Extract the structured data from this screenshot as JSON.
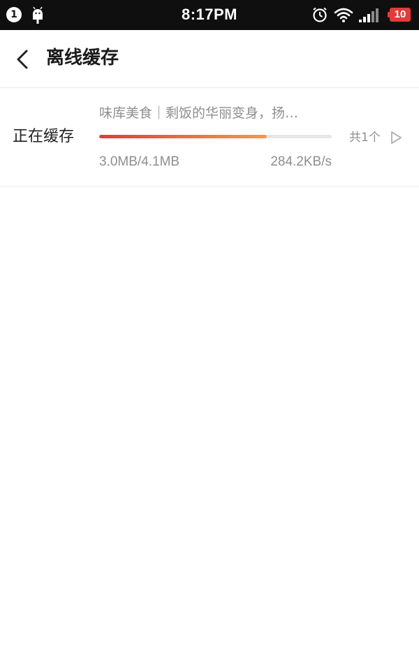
{
  "status_bar": {
    "notification_count": "1",
    "time": "8:17PM",
    "battery_level": "10",
    "icons": [
      "android-icon",
      "alarm-icon",
      "wifi-icon",
      "signal-icon",
      "battery-icon"
    ],
    "colors": {
      "background": "#0f0f0f",
      "battery": "#e23b3b"
    }
  },
  "header": {
    "back_icon": "chevron-left-icon",
    "title": "离线缓存"
  },
  "cache_section": {
    "label": "正在缓存",
    "item_title": "味库美食｜剩饭的华丽变身，扬…",
    "progress_fraction": 0.72,
    "size": "3.0MB/4.1MB",
    "speed": "284.2KB/s",
    "count": "共1个",
    "arrow_icon": "play-outline-icon",
    "colors": {
      "progress_start": "#e03c3f",
      "progress_end": "#f39a4c",
      "track": "#e6e6e6"
    }
  }
}
